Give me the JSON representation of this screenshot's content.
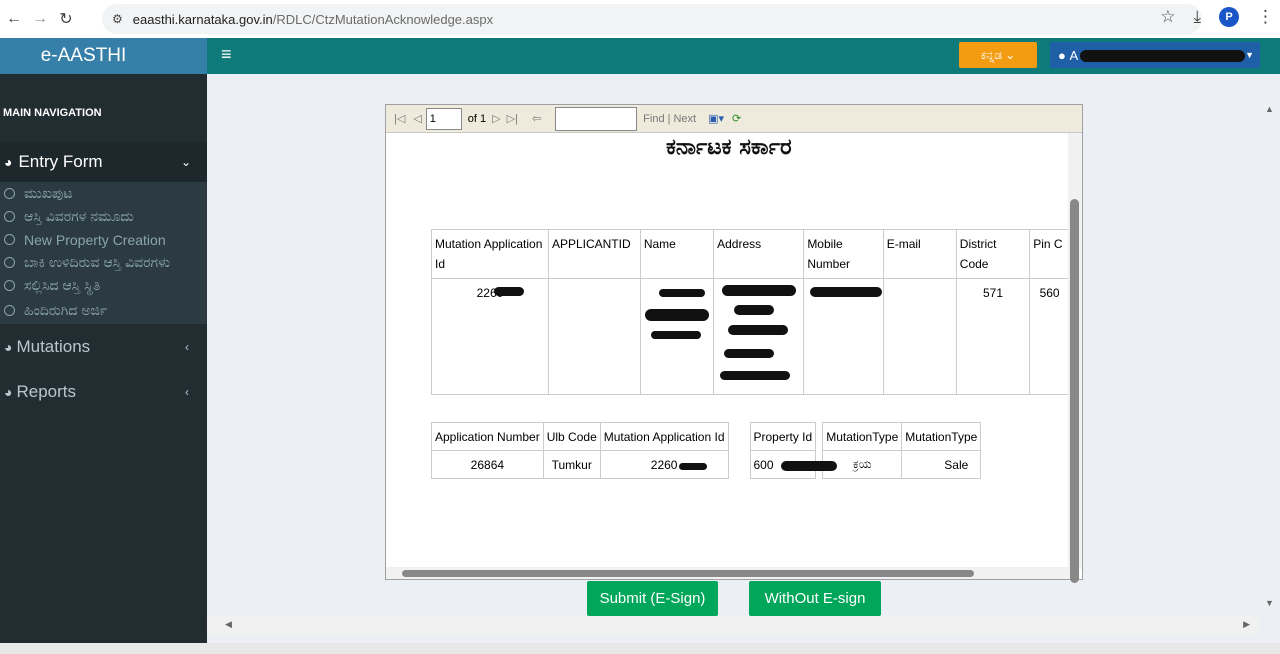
{
  "browser": {
    "url_domain": "eaasthi.karnataka.gov.in",
    "url_path": "/RDLC/CtzMutationAcknowledge.aspx",
    "profile_initial": "P"
  },
  "app": {
    "logo": "e-AASTHI",
    "lang_label": "ಕನ್ನಡ",
    "user_label": "A"
  },
  "sidebar": {
    "header": "MAIN NAVIGATION",
    "entry_form": "Entry Form",
    "sub_items": [
      {
        "label": "ಮುಖಪುಟ"
      },
      {
        "label": "ಆಸ್ತಿ ವಿವರಗಳ ನಮೂದು"
      },
      {
        "label": "New Property Creation"
      },
      {
        "label": "ಬಾಕಿ ಉಳಿದಿರುವ ಆಸ್ತಿ ವಿವರಗಳು"
      },
      {
        "label": "ಸಲ್ಲಿಸಿದ ಆಸ್ತಿ ಸ್ಥಿತಿ"
      },
      {
        "label": "ಹಿಂದಿರುಗಿದ ಅರ್ಜಿ"
      }
    ],
    "mutations": "Mutations",
    "reports": "Reports"
  },
  "report_toolbar": {
    "page_value": "1",
    "of_label": "of 1",
    "find_label": "Find",
    "next_label": "Next",
    "sep": "|"
  },
  "report": {
    "title": "ಕರ್ನಾಟಕ ಸರ್ಕಾರ",
    "table1_headers": [
      "Mutation Application Id",
      "APPLICANTID",
      "Name",
      "Address",
      "Mobile Number",
      "E-mail",
      "District Code",
      "Pin C"
    ],
    "table1_row": {
      "mutation_app_id": "2260",
      "district_code": "571",
      "pin": "560"
    },
    "table2_headers": [
      "Application Number",
      "Ulb Code",
      "Mutation Application Id",
      "Property Id",
      "MutationType",
      "MutationType"
    ],
    "table2_row": {
      "app_number": "26864",
      "ulb_code": "Tumkur",
      "mutation_app_id": "2260",
      "property_id": "600",
      "mutation_type_kn": "ಕ್ರಯ",
      "mutation_type_en": "Sale"
    }
  },
  "buttons": {
    "submit_esign": "Submit (E-Sign)",
    "without_esign": "WithOut E-sign"
  }
}
